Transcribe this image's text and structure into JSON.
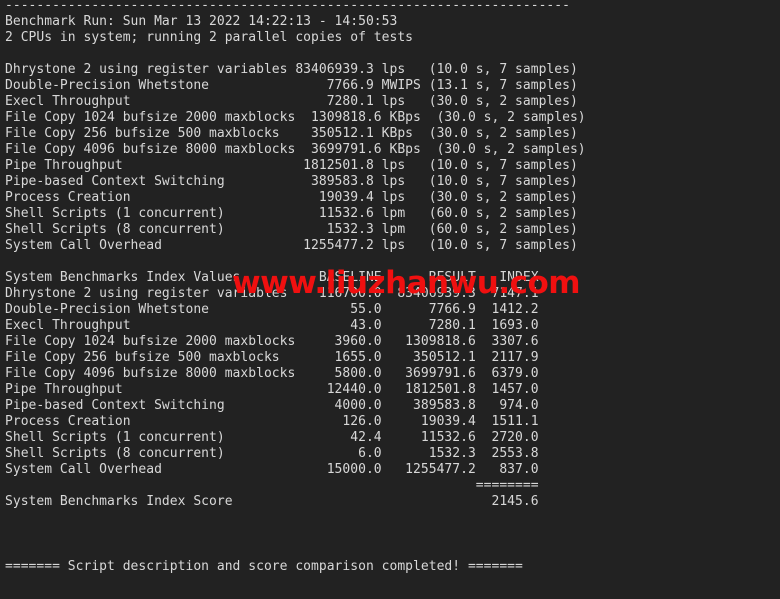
{
  "terminal": {
    "background_color": "#222222",
    "text_color": "#d8d8d8",
    "watermark_color": "#f01010",
    "watermark_text": "www.liuzhanwu.com",
    "top_rule": "------------------------------------------------------------------------",
    "header": {
      "run_line": "Benchmark Run: Sun Mar 13 2022 14:22:13 - 14:50:53",
      "cpu_line": "2 CPUs in system; running 2 parallel copies of tests"
    },
    "raw_results": {
      "rows": [
        {
          "name": "Dhrystone 2 using register variables",
          "value": "83406939.3",
          "unit": "lps",
          "timing": "(10.0 s, 7 samples)"
        },
        {
          "name": "Double-Precision Whetstone",
          "value": "7766.9",
          "unit": "MWIPS",
          "timing": "(13.1 s, 7 samples)"
        },
        {
          "name": "Execl Throughput",
          "value": "7280.1",
          "unit": "lps",
          "timing": "(30.0 s, 2 samples)"
        },
        {
          "name": "File Copy 1024 bufsize 2000 maxblocks",
          "value": "1309818.6",
          "unit": "KBps",
          "timing": "(30.0 s, 2 samples)"
        },
        {
          "name": "File Copy 256 bufsize 500 maxblocks",
          "value": "350512.1",
          "unit": "KBps",
          "timing": "(30.0 s, 2 samples)"
        },
        {
          "name": "File Copy 4096 bufsize 8000 maxblocks",
          "value": "3699791.6",
          "unit": "KBps",
          "timing": "(30.0 s, 2 samples)"
        },
        {
          "name": "Pipe Throughput",
          "value": "1812501.8",
          "unit": "lps",
          "timing": "(10.0 s, 7 samples)"
        },
        {
          "name": "Pipe-based Context Switching",
          "value": "389583.8",
          "unit": "lps",
          "timing": "(10.0 s, 7 samples)"
        },
        {
          "name": "Process Creation",
          "value": "19039.4",
          "unit": "lps",
          "timing": "(30.0 s, 2 samples)"
        },
        {
          "name": "Shell Scripts (1 concurrent)",
          "value": "11532.6",
          "unit": "lpm",
          "timing": "(60.0 s, 2 samples)"
        },
        {
          "name": "Shell Scripts (8 concurrent)",
          "value": "1532.3",
          "unit": "lpm",
          "timing": "(60.0 s, 2 samples)"
        },
        {
          "name": "System Call Overhead",
          "value": "1255477.2",
          "unit": "lps",
          "timing": "(10.0 s, 7 samples)"
        }
      ]
    },
    "index_table": {
      "title": "System Benchmarks Index Values",
      "columns": [
        "BASELINE",
        "RESULT",
        "INDEX"
      ],
      "rows": [
        {
          "name": "Dhrystone 2 using register variables",
          "baseline": "116700.0",
          "result": "83406939.3",
          "index": "7147.1"
        },
        {
          "name": "Double-Precision Whetstone",
          "baseline": "55.0",
          "result": "7766.9",
          "index": "1412.2"
        },
        {
          "name": "Execl Throughput",
          "baseline": "43.0",
          "result": "7280.1",
          "index": "1693.0"
        },
        {
          "name": "File Copy 1024 bufsize 2000 maxblocks",
          "baseline": "3960.0",
          "result": "1309818.6",
          "index": "3307.6"
        },
        {
          "name": "File Copy 256 bufsize 500 maxblocks",
          "baseline": "1655.0",
          "result": "350512.1",
          "index": "2117.9"
        },
        {
          "name": "File Copy 4096 bufsize 8000 maxblocks",
          "baseline": "5800.0",
          "result": "3699791.6",
          "index": "6379.0"
        },
        {
          "name": "Pipe Throughput",
          "baseline": "12440.0",
          "result": "1812501.8",
          "index": "1457.0"
        },
        {
          "name": "Pipe-based Context Switching",
          "baseline": "4000.0",
          "result": "389583.8",
          "index": "974.0"
        },
        {
          "name": "Process Creation",
          "baseline": "126.0",
          "result": "19039.4",
          "index": "1511.1"
        },
        {
          "name": "Shell Scripts (1 concurrent)",
          "baseline": "42.4",
          "result": "11532.6",
          "index": "2720.0"
        },
        {
          "name": "Shell Scripts (8 concurrent)",
          "baseline": "6.0",
          "result": "1532.3",
          "index": "2553.8"
        },
        {
          "name": "System Call Overhead",
          "baseline": "15000.0",
          "result": "1255477.2",
          "index": "837.0"
        }
      ],
      "separator": "========",
      "score_label": "System Benchmarks Index Score",
      "score_value": "2145.6"
    },
    "footer": {
      "completed_line": "======= Script description and score comparison completed! ======="
    }
  }
}
